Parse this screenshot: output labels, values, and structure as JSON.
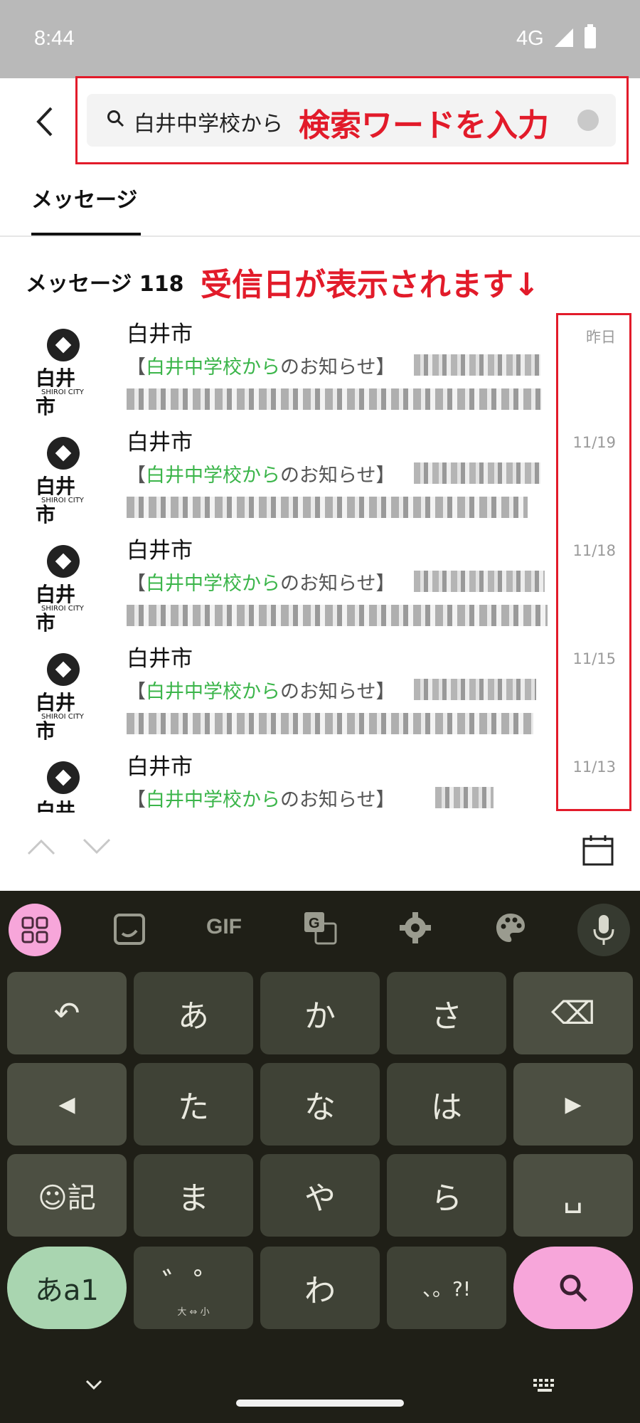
{
  "status_bar": {
    "time": "8:44",
    "network": "4G"
  },
  "header": {
    "back_icon": "chevron-left-icon",
    "search": {
      "value": "白井中学校から",
      "icon": "search-icon"
    },
    "annotation": "検索ワードを入力"
  },
  "tabs": [
    {
      "label": "メッセージ",
      "active": true
    }
  ],
  "results": {
    "count_label": "メッセージ 118",
    "annotation": "受信日が表示されます↓"
  },
  "messages": [
    {
      "sender": "白井市",
      "prefix": "【",
      "highlight": "白井中学校から",
      "suffix": "のお知らせ】",
      "date": "昨日",
      "logo_text": "白井市",
      "logo_sub": "SHIROI CITY"
    },
    {
      "sender": "白井市",
      "prefix": "【",
      "highlight": "白井中学校から",
      "suffix": "のお知らせ】",
      "date": "11/19",
      "logo_text": "白井市",
      "logo_sub": "SHIROI CITY"
    },
    {
      "sender": "白井市",
      "prefix": "【",
      "highlight": "白井中学校から",
      "suffix": "のお知らせ】",
      "date": "11/18",
      "logo_text": "白井市",
      "logo_sub": "SHIROI CITY"
    },
    {
      "sender": "白井市",
      "prefix": "【",
      "highlight": "白井中学校から",
      "suffix": "のお知らせ】",
      "date": "11/15",
      "logo_text": "白井市",
      "logo_sub": "SHIROI CITY"
    },
    {
      "sender": "白井市",
      "prefix": "【",
      "highlight": "白井中学校から",
      "suffix": "のお知らせ】",
      "date": "11/13",
      "logo_text": "白井市",
      "logo_sub": ""
    }
  ],
  "keyboard": {
    "toolbar": {
      "gif": "GIF"
    },
    "rows": [
      [
        "↶",
        "あ",
        "か",
        "さ",
        "⌫"
      ],
      [
        "◀",
        "た",
        "な",
        "は",
        "▶"
      ],
      [
        "☺記",
        "ま",
        "や",
        "ら",
        "␣"
      ],
      [
        "あa1",
        "゛゜",
        "わ",
        "、。?!",
        "search"
      ]
    ],
    "dakuten_sub": "大 ⇔ 小"
  },
  "colors": {
    "annotation_red": "#e21b2a",
    "highlight_green": "#3bb54a",
    "keyboard_bg": "#1f1f17",
    "accent_pink": "#f7a6da"
  }
}
